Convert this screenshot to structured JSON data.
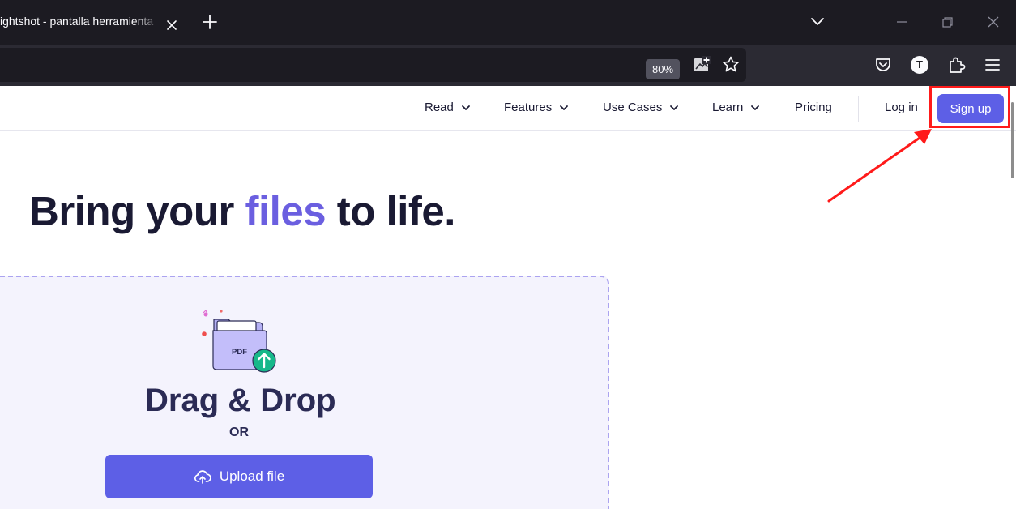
{
  "browser": {
    "tab_title": "ightshot - pantalla herramienta",
    "zoom": "80%",
    "profile_initial": "T"
  },
  "site": {
    "nav": [
      {
        "label": "Read",
        "has_dropdown": true
      },
      {
        "label": "Features",
        "has_dropdown": true
      },
      {
        "label": "Use Cases",
        "has_dropdown": true
      },
      {
        "label": "Learn",
        "has_dropdown": true
      },
      {
        "label": "Pricing",
        "has_dropdown": false
      }
    ],
    "login_label": "Log in",
    "signup_label": "Sign up",
    "accent_color": "#5d5fe6"
  },
  "hero": {
    "prefix": "Bring your ",
    "accent": "files",
    "suffix": " to life."
  },
  "dropzone": {
    "icon_label": "PDF",
    "title": "Drag & Drop",
    "or_label": "OR",
    "upload_label": "Upload file"
  }
}
